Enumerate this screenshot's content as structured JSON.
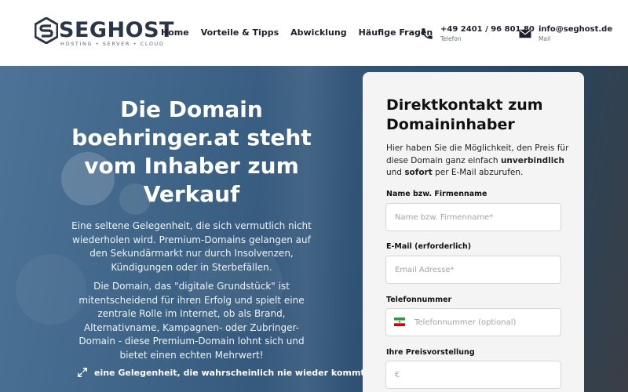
{
  "header": {
    "logo": {
      "word": "SEGHOST",
      "tagline": "HOSTING • SERVER • CLOUD"
    },
    "nav": [
      {
        "label": "Home"
      },
      {
        "label": "Vorteile & Tipps"
      },
      {
        "label": "Abwicklung"
      },
      {
        "label": "Häufige Fragen"
      }
    ],
    "phone": {
      "value": "+49 2401 / 96 801 80",
      "label": "Telefon"
    },
    "mail": {
      "value": "info@seghost.de",
      "label": "Mail"
    }
  },
  "hero": {
    "title": "Die Domain boehringer.at steht vom Inhaber zum Verkauf",
    "paragraph1": "Eine seltene Gelegenheit, die sich vermutlich nicht wiederholen wird. Premium-Domains gelangen auf den Sekundärmarkt nur durch Insolvenzen, Kündigungen oder in Sterbefällen.",
    "paragraph2": "Die Domain, das \"digitale Grundstück\" ist mitentscheidend für ihren Erfolg und spielt eine zentrale Rolle im Internet, ob als Brand, Alternativname, Kampagnen- oder Zubringer-Domain - diese Premium-Domain lohnt sich und bietet einen echten Mehrwert!",
    "feature1": "eine Gelegenheit, die wahrscheinlich nie wieder kommt"
  },
  "form": {
    "title": "Direktkontakt zum Domaininhaber",
    "intro_pre": "Hier haben Sie die Möglichkeit, den Preis für diese Domain ganz einfach ",
    "intro_b1": "unverbindlich",
    "intro_mid": " und ",
    "intro_b2": "sofort",
    "intro_post": " per E-Mail abzurufen.",
    "name_label": "Name bzw. Firmenname",
    "name_placeholder": "Name bzw. Firmenname*",
    "email_label": "E-Mail (erforderlich)",
    "email_placeholder": "Email Adresse*",
    "phone_label": "Telefonnummer",
    "phone_placeholder": "Telefonnummer (optional)",
    "price_label": "Ihre Preisvorstellung",
    "price_placeholder": "€"
  },
  "colors": {
    "brand_dark": "#2a3547",
    "hero_blue": "#3d6386",
    "panel_bg": "#f4f4f4"
  }
}
